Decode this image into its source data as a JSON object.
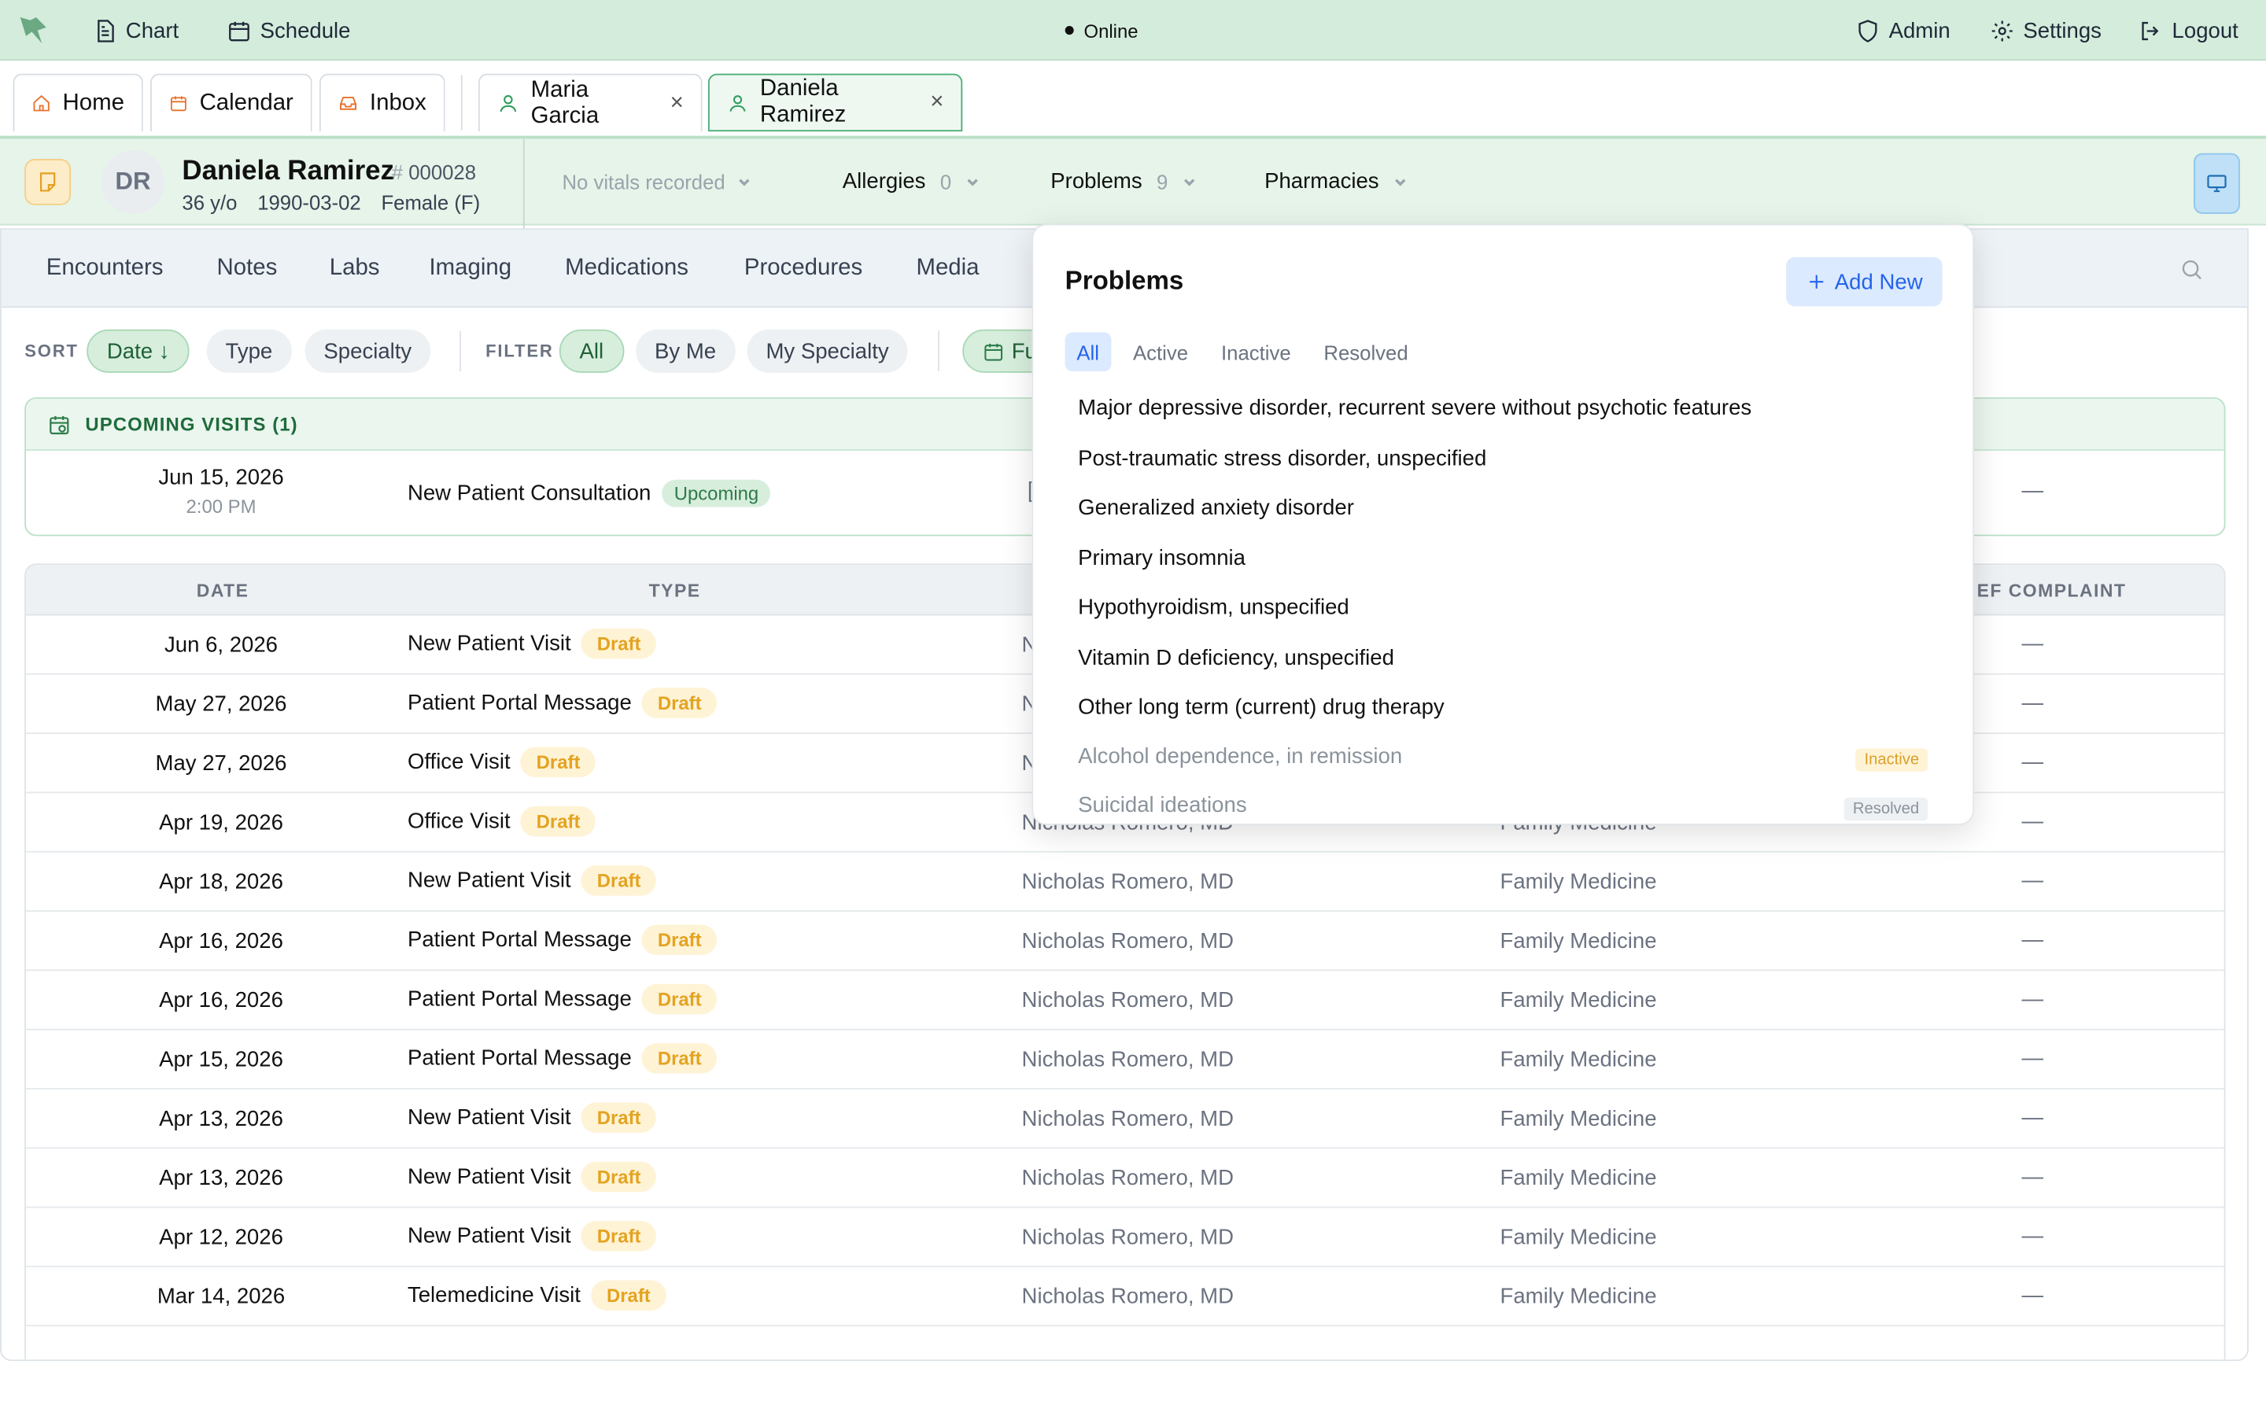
{
  "topbar": {
    "chart": "Chart",
    "schedule": "Schedule",
    "status": "Online",
    "admin": "Admin",
    "settings": "Settings",
    "logout": "Logout"
  },
  "tabs": {
    "home": "Home",
    "calendar": "Calendar",
    "inbox": "Inbox",
    "patient1": "Maria Garcia",
    "patient2": "Daniela Ramirez",
    "close": "×"
  },
  "patient": {
    "initials": "DR",
    "name": "Daniela Ramirez",
    "hash": "#",
    "id": "000028",
    "age": "36 y/o",
    "dob": "1990-03-02",
    "sex": "Female (F)",
    "vitals": "No vitals recorded",
    "allergies_label": "Allergies",
    "allergies_count": "0",
    "problems_label": "Problems",
    "problems_count": "9",
    "pharmacies_label": "Pharmacies"
  },
  "nav": [
    "Encounters",
    "Notes",
    "Labs",
    "Imaging",
    "Medications",
    "Procedures",
    "Media"
  ],
  "filters": {
    "sort_label": "SORT",
    "sort_date": "Date ↓",
    "sort_type": "Type",
    "sort_specialty": "Specialty",
    "filter_label": "FILTER",
    "all": "All",
    "by_me": "By Me",
    "my_specialty": "My Specialty",
    "future": "Fu"
  },
  "upcoming": {
    "header": "UPCOMING VISITS (1)",
    "date": "Jun 15, 2026",
    "time": "2:00 PM",
    "type": "New Patient Consultation",
    "badge": "Upcoming",
    "provider_partial": "[",
    "complaint": "—"
  },
  "table": {
    "headers": {
      "date": "DATE",
      "type": "TYPE",
      "complaint": "EF COMPLAINT"
    },
    "draft": "Draft",
    "rows": [
      {
        "date": "Jun 6, 2026",
        "type": "New Patient Visit",
        "provider": "N",
        "specialty": "",
        "complaint": "—"
      },
      {
        "date": "May 27, 2026",
        "type": "Patient Portal Message",
        "provider": "N",
        "specialty": "",
        "complaint": "—"
      },
      {
        "date": "May 27, 2026",
        "type": "Office Visit",
        "provider": "N",
        "specialty": "",
        "complaint": "—"
      },
      {
        "date": "Apr 19, 2026",
        "type": "Office Visit",
        "provider": "Nicholas Romero, MD",
        "specialty": "Family Medicine",
        "complaint": "—"
      },
      {
        "date": "Apr 18, 2026",
        "type": "New Patient Visit",
        "provider": "Nicholas Romero, MD",
        "specialty": "Family Medicine",
        "complaint": "—"
      },
      {
        "date": "Apr 16, 2026",
        "type": "Patient Portal Message",
        "provider": "Nicholas Romero, MD",
        "specialty": "Family Medicine",
        "complaint": "—"
      },
      {
        "date": "Apr 16, 2026",
        "type": "Patient Portal Message",
        "provider": "Nicholas Romero, MD",
        "specialty": "Family Medicine",
        "complaint": "—"
      },
      {
        "date": "Apr 15, 2026",
        "type": "Patient Portal Message",
        "provider": "Nicholas Romero, MD",
        "specialty": "Family Medicine",
        "complaint": "—"
      },
      {
        "date": "Apr 13, 2026",
        "type": "New Patient Visit",
        "provider": "Nicholas Romero, MD",
        "specialty": "Family Medicine",
        "complaint": "—"
      },
      {
        "date": "Apr 13, 2026",
        "type": "New Patient Visit",
        "provider": "Nicholas Romero, MD",
        "specialty": "Family Medicine",
        "complaint": "—"
      },
      {
        "date": "Apr 12, 2026",
        "type": "New Patient Visit",
        "provider": "Nicholas Romero, MD",
        "specialty": "Family Medicine",
        "complaint": "—"
      },
      {
        "date": "Mar 14, 2026",
        "type": "Telemedicine Visit",
        "provider": "Nicholas Romero, MD",
        "specialty": "Family Medicine",
        "complaint": "—"
      }
    ]
  },
  "popover": {
    "title": "Problems",
    "add_new": "Add New",
    "filters": [
      "All",
      "Active",
      "Inactive",
      "Resolved"
    ],
    "items": [
      {
        "name": "Major depressive disorder, recurrent severe without psychotic features",
        "status": ""
      },
      {
        "name": "Post-traumatic stress disorder, unspecified",
        "status": ""
      },
      {
        "name": "Generalized anxiety disorder",
        "status": ""
      },
      {
        "name": "Primary insomnia",
        "status": ""
      },
      {
        "name": "Hypothyroidism, unspecified",
        "status": ""
      },
      {
        "name": "Vitamin D deficiency, unspecified",
        "status": ""
      },
      {
        "name": "Other long term (current) drug therapy",
        "status": ""
      },
      {
        "name": "Alcohol dependence, in remission",
        "status": "Inactive"
      },
      {
        "name": "Suicidal ideations",
        "status": "Resolved"
      }
    ]
  },
  "colors": {
    "topbar": "#d4ecdc",
    "accent_green": "#4caf78",
    "draft": "#e4a320",
    "link_blue": "#2563eb"
  }
}
